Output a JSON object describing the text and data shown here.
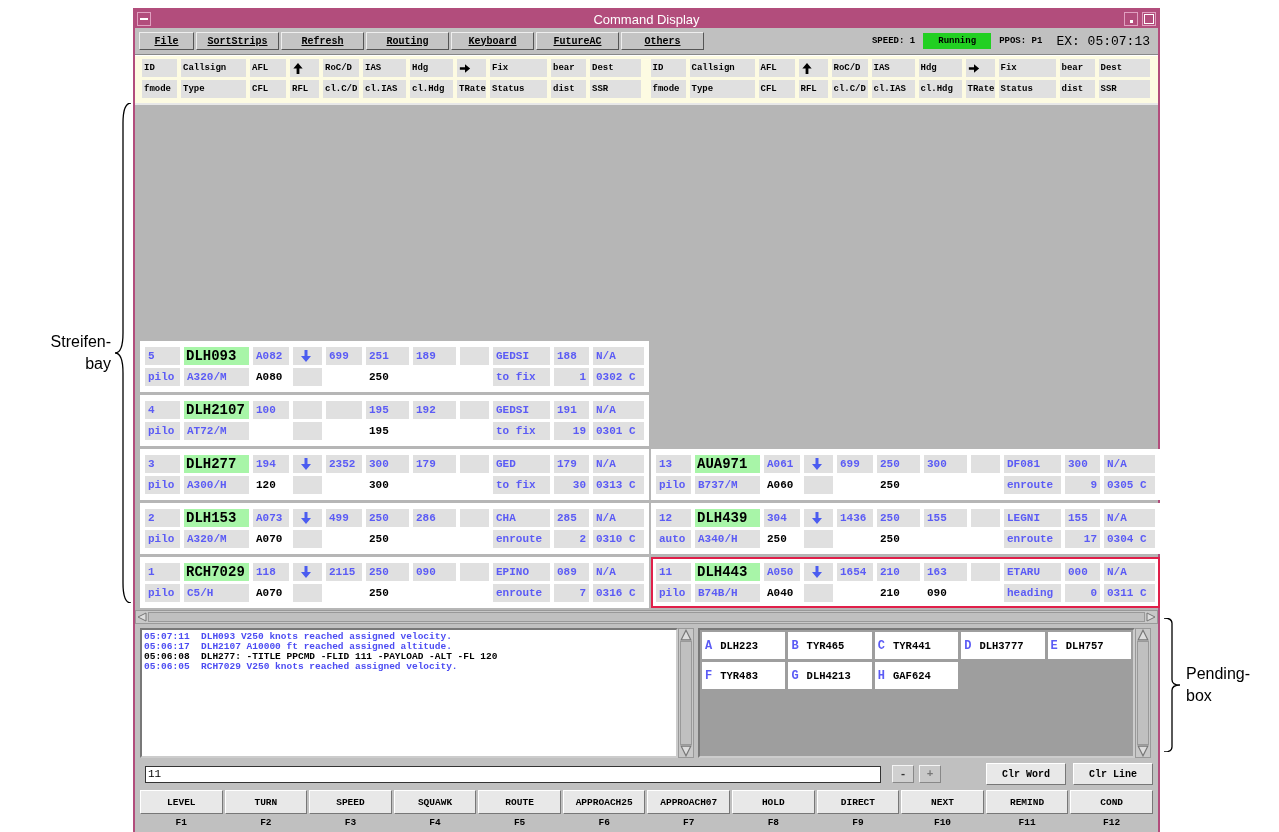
{
  "window": {
    "title": "Command Display"
  },
  "menu": [
    {
      "label": "File"
    },
    {
      "label": "SortStrips"
    },
    {
      "label": "Refresh"
    },
    {
      "label": "Routing"
    },
    {
      "label": "Keyboard"
    },
    {
      "label": "FutureAC"
    },
    {
      "label": "Others"
    }
  ],
  "status": {
    "speed": "SPEED: 1",
    "state": "Running",
    "running": true,
    "ppos": "PPOS: P1",
    "clock": "EX: 05:07:13"
  },
  "header": [
    {
      "row_1": [
        {
          "label": "ID"
        },
        {
          "label": "Callsign"
        },
        {
          "label": "AFL"
        },
        {
          "kind": "icon"
        },
        {
          "label": "RoC/D"
        },
        {
          "label": "IAS"
        },
        {
          "label": "Hdg"
        },
        {
          "kind": "icon"
        },
        {
          "label": "Fix"
        },
        {
          "label": "bear"
        },
        {
          "label": "Dest"
        }
      ],
      "row_2": [
        {
          "label": "fmode"
        },
        {
          "label": "Type"
        },
        {
          "label": "CFL"
        },
        {
          "label": "RFL"
        },
        {
          "label": "cl.C/D"
        },
        {
          "label": "cl.IAS"
        },
        {
          "label": "cl.Hdg"
        },
        {
          "label": "TRate"
        },
        {
          "label": "Status"
        },
        {
          "label": "dist"
        },
        {
          "label": "SSR"
        }
      ]
    },
    {
      "row_1": [
        {
          "label": "ID"
        },
        {
          "label": "Callsign"
        },
        {
          "label": "AFL"
        },
        {
          "kind": "icon"
        },
        {
          "label": "RoC/D"
        },
        {
          "label": "IAS"
        },
        {
          "label": "Hdg"
        },
        {
          "kind": "icon"
        },
        {
          "label": "Fix"
        },
        {
          "label": "bear"
        },
        {
          "label": "Dest"
        }
      ],
      "row_2": [
        {
          "label": "fmode"
        },
        {
          "label": "Type"
        },
        {
          "label": "CFL"
        },
        {
          "label": "RFL"
        },
        {
          "label": "cl.C/D"
        },
        {
          "label": "cl.IAS"
        },
        {
          "label": "cl.Hdg"
        },
        {
          "label": "TRate"
        },
        {
          "label": "Status"
        },
        {
          "label": "dist"
        },
        {
          "label": "SSR"
        }
      ]
    }
  ],
  "strip_bays": [
    {
      "strips": [
        {
          "id": "5",
          "callsign": "DLH093",
          "afl": "A082",
          "descending": true,
          "roc": "699",
          "ias": "251",
          "hdg": "189",
          "fix": "GEDSI",
          "bear": "188",
          "dest": "N/A",
          "fmode": "pilo",
          "type": "A320/M",
          "cfl": "A080",
          "cl_ias": "250",
          "status": "to fix",
          "dist": "1",
          "ssr": "0302 C",
          "selected": false
        },
        {
          "id": "4",
          "callsign": "DLH2107",
          "afl": "100",
          "descending": false,
          "ias": "195",
          "hdg": "192",
          "fix": "GEDSI",
          "bear": "191",
          "dest": "N/A",
          "fmode": "pilo",
          "type": "AT72/M",
          "cl_ias": "195",
          "status": "to fix",
          "dist": "19",
          "ssr": "0301 C",
          "selected": false
        },
        {
          "id": "3",
          "callsign": "DLH277",
          "afl": "194",
          "descending": true,
          "roc": "2352",
          "ias": "300",
          "hdg": "179",
          "fix": "GED",
          "bear": "179",
          "dest": "N/A",
          "fmode": "pilo",
          "type": "A300/H",
          "cfl": "120",
          "cl_ias": "300",
          "status": "to fix",
          "dist": "30",
          "ssr": "0313 C",
          "selected": false
        },
        {
          "id": "2",
          "callsign": "DLH153",
          "afl": "A073",
          "descending": true,
          "roc": "499",
          "ias": "250",
          "hdg": "286",
          "fix": "CHA",
          "bear": "285",
          "dest": "N/A",
          "fmode": "pilo",
          "type": "A320/M",
          "cfl": "A070",
          "cl_ias": "250",
          "status": "enroute",
          "dist": "2",
          "ssr": "0310 C",
          "selected": false
        },
        {
          "id": "1",
          "callsign": "RCH7029",
          "afl": "118",
          "descending": true,
          "roc": "2115",
          "ias": "250",
          "hdg": "090",
          "fix": "EPINO",
          "bear": "089",
          "dest": "N/A",
          "fmode": "pilo",
          "type": "C5/H",
          "cfl": "A070",
          "cl_ias": "250",
          "status": "enroute",
          "dist": "7",
          "ssr": "0316 C",
          "selected": false
        }
      ]
    },
    {
      "strips": [
        {
          "id": "13",
          "callsign": "AUA971",
          "afl": "A061",
          "descending": true,
          "roc": "699",
          "ias": "250",
          "hdg": "300",
          "fix": "DF081",
          "bear": "300",
          "dest": "N/A",
          "fmode": "pilo",
          "type": "B737/M",
          "cfl": "A060",
          "cl_ias": "250",
          "status": "enroute",
          "dist": "9",
          "ssr": "0305 C",
          "selected": false
        },
        {
          "id": "12",
          "callsign": "DLH439",
          "afl": "304",
          "descending": true,
          "roc": "1436",
          "ias": "250",
          "hdg": "155",
          "fix": "LEGNI",
          "bear": "155",
          "dest": "N/A",
          "fmode": "auto",
          "type": "A340/H",
          "cfl": "250",
          "cl_ias": "250",
          "status": "enroute",
          "dist": "17",
          "ssr": "0304 C",
          "selected": false
        },
        {
          "id": "11",
          "callsign": "DLH443",
          "afl": "A050",
          "descending": true,
          "roc": "1654",
          "ias": "210",
          "hdg": "163",
          "fix": "ETARU",
          "bear": "000",
          "dest": "N/A",
          "fmode": "pilo",
          "type": "B74B/H",
          "cfl": "A040",
          "cl_ias": "210",
          "cl_hdg": "090",
          "status": "heading",
          "dist": "0",
          "ssr": "0311 C",
          "selected": true
        }
      ]
    }
  ],
  "message_log": [
    {
      "time": "05:07:11",
      "text": "DLH093 V250 knots reached assigned velocity.",
      "kind": "report"
    },
    {
      "time": "05:06:17",
      "text": "DLH2107 A10000 ft reached assigned altitude.",
      "kind": "report"
    },
    {
      "time": "05:06:08",
      "text": "DLH277: -TITLE PPCMD -FLID 111 -PAYLOAD -ALT -FL 120",
      "kind": "command"
    },
    {
      "time": "05:06:05",
      "text": "RCH7029 V250 knots reached assigned velocity.",
      "kind": "report"
    }
  ],
  "pending": [
    {
      "letter": "A",
      "callsign": "DLH223"
    },
    {
      "letter": "B",
      "callsign": "TYR465"
    },
    {
      "letter": "C",
      "callsign": "TYR441"
    },
    {
      "letter": "D",
      "callsign": "DLH3777"
    },
    {
      "letter": "E",
      "callsign": "DLH757"
    },
    {
      "letter": "F",
      "callsign": "TYR483"
    },
    {
      "letter": "G",
      "callsign": "DLH4213"
    },
    {
      "letter": "H",
      "callsign": "GAF624"
    }
  ],
  "command_line": {
    "value": "11"
  },
  "step_buttons": [
    {
      "label": "-",
      "disabled": false
    },
    {
      "label": "+",
      "disabled": true
    }
  ],
  "clear_buttons": [
    "Clr Word",
    "Clr Line"
  ],
  "function_keys": [
    {
      "label": "LEVEL",
      "key": "F1"
    },
    {
      "label": "TURN",
      "key": "F2"
    },
    {
      "label": "SPEED",
      "key": "F3"
    },
    {
      "label": "SQUAWK",
      "key": "F4"
    },
    {
      "label": "ROUTE",
      "key": "F5"
    },
    {
      "label": "APPROACH25",
      "key": "F6"
    },
    {
      "label": "APPROACH07",
      "key": "F7"
    },
    {
      "label": "HOLD",
      "key": "F8"
    },
    {
      "label": "DIRECT",
      "key": "F9"
    },
    {
      "label": "NEXT",
      "key": "F10"
    },
    {
      "label": "REMIND",
      "key": "F11"
    },
    {
      "label": "COND",
      "key": "F12"
    }
  ],
  "annotations": [
    {
      "lines": [
        "Streifen-",
        "bay"
      ]
    },
    {
      "lines": [
        "Pending-",
        "box"
      ]
    }
  ]
}
